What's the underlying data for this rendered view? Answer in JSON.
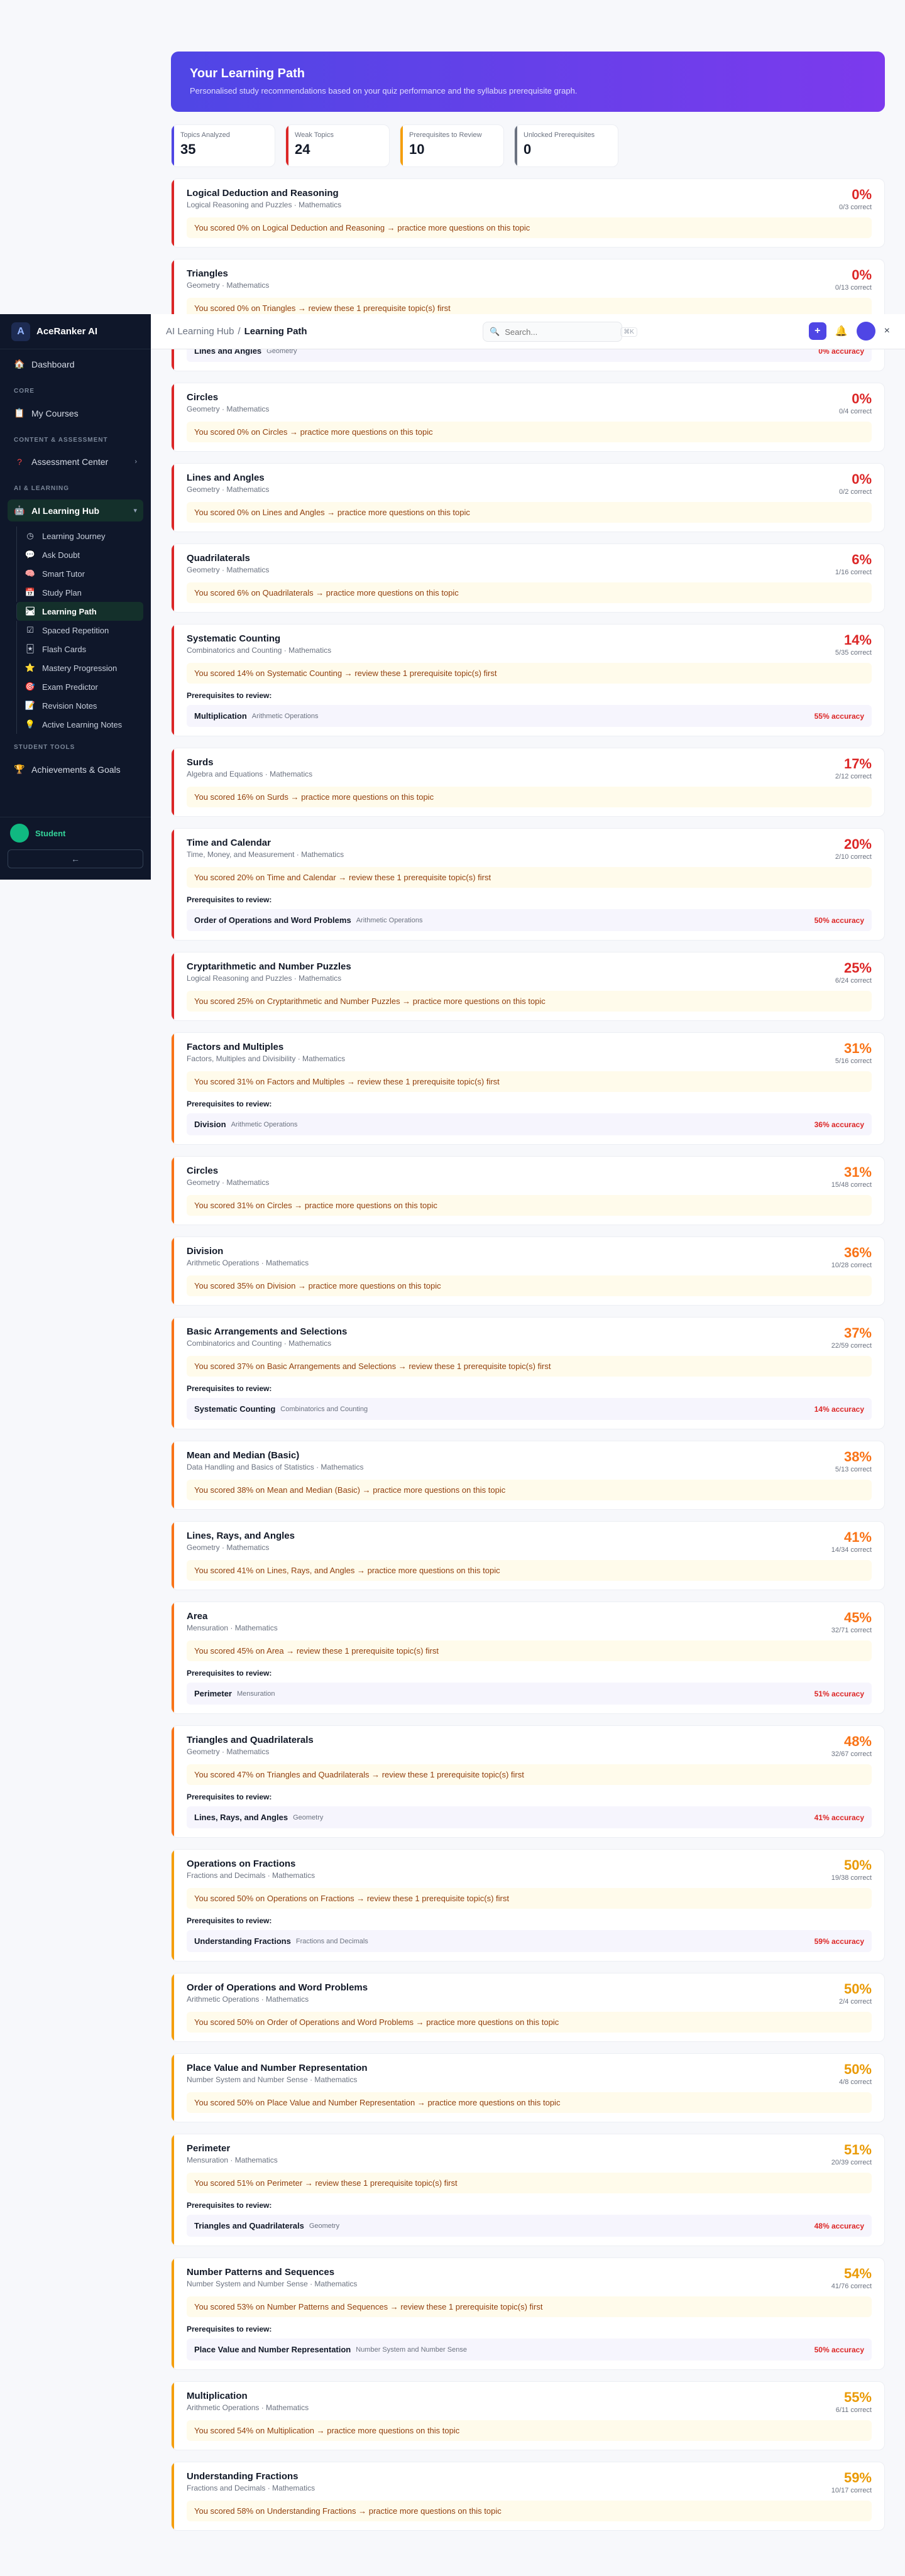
{
  "brand": {
    "logo": "A",
    "name": "AceRanker AI"
  },
  "sidebar": {
    "dashboard": "Dashboard",
    "section_core": "CORE",
    "my_courses": "My Courses",
    "section_content": "CONTENT & ASSESSMENT",
    "assessment_center": "Assessment Center",
    "section_ai": "AI & LEARNING",
    "ai_hub": "AI Learning Hub",
    "sub_items": [
      {
        "label": "Learning Journey",
        "icon": "clock-icon",
        "glyph": "◷"
      },
      {
        "label": "Ask Doubt",
        "icon": "chat-icon",
        "glyph": "💬"
      },
      {
        "label": "Smart Tutor",
        "icon": "brain-icon",
        "glyph": "🧠"
      },
      {
        "label": "Study Plan",
        "icon": "calendar-icon",
        "glyph": "📅"
      },
      {
        "label": "Learning Path",
        "icon": "path-icon",
        "glyph": "🛤"
      },
      {
        "label": "Spaced Repetition",
        "icon": "check-icon",
        "glyph": "☑"
      },
      {
        "label": "Flash Cards",
        "icon": "cards-icon",
        "glyph": "🃏"
      },
      {
        "label": "Mastery Progression",
        "icon": "star-icon",
        "glyph": "⭐"
      },
      {
        "label": "Exam Predictor",
        "icon": "target-icon",
        "glyph": "🎯"
      },
      {
        "label": "Revision Notes",
        "icon": "notes-icon",
        "glyph": "📝"
      },
      {
        "label": "Active Learning Notes",
        "icon": "bulb-icon",
        "glyph": "💡"
      }
    ],
    "section_tools": "STUDENT TOOLS",
    "achievements": "Achievements & Goals",
    "user_name": "Student",
    "collapse": "←"
  },
  "topbar": {
    "crumb_parent": "AI Learning Hub",
    "crumb_sep": "/",
    "crumb_current": "Learning Path",
    "search_placeholder": "Search...",
    "search_kbd": "⌘K",
    "add": "+",
    "bell": "🔔",
    "close": "×"
  },
  "hero": {
    "title": "Your Learning Path",
    "subtitle": "Personalised study recommendations based on your quiz performance and the syllabus prerequisite graph."
  },
  "stats": [
    {
      "label": "Topics Analyzed",
      "value": "35"
    },
    {
      "label": "Weak Topics",
      "value": "24"
    },
    {
      "label": "Prerequisites to Review",
      "value": "10"
    },
    {
      "label": "Unlocked Prerequisites",
      "value": "0"
    }
  ],
  "prereq_label": "Prerequisites to review:",
  "topics": [
    {
      "title": "Logical Deduction and Reasoning",
      "sub": "Logical Reasoning and Puzzles · Mathematics",
      "pct": "0%",
      "correct": "0/3 correct",
      "tone": "red",
      "reco": "You scored 0% on Logical Deduction and Reasoning → practice more questions on this topic"
    },
    {
      "title": "Triangles",
      "sub": "Geometry · Mathematics",
      "pct": "0%",
      "correct": "0/13 correct",
      "tone": "red",
      "reco": "You scored 0% on Triangles → review these 1 prerequisite topic(s) first",
      "prereq": {
        "name": "Lines and Angles",
        "sub": "Geometry",
        "acc": "0% accuracy"
      }
    },
    {
      "title": "Circles",
      "sub": "Geometry · Mathematics",
      "pct": "0%",
      "correct": "0/4 correct",
      "tone": "red",
      "reco": "You scored 0% on Circles → practice more questions on this topic"
    },
    {
      "title": "Lines and Angles",
      "sub": "Geometry · Mathematics",
      "pct": "0%",
      "correct": "0/2 correct",
      "tone": "red",
      "reco": "You scored 0% on Lines and Angles → practice more questions on this topic"
    },
    {
      "title": "Quadrilaterals",
      "sub": "Geometry · Mathematics",
      "pct": "6%",
      "correct": "1/16 correct",
      "tone": "red",
      "reco": "You scored 6% on Quadrilaterals → practice more questions on this topic"
    },
    {
      "title": "Systematic Counting",
      "sub": "Combinatorics and Counting · Mathematics",
      "pct": "14%",
      "correct": "5/35 correct",
      "tone": "red",
      "reco": "You scored 14% on Systematic Counting → review these 1 prerequisite topic(s) first",
      "prereq": {
        "name": "Multiplication",
        "sub": "Arithmetic Operations",
        "acc": "55% accuracy"
      }
    },
    {
      "title": "Surds",
      "sub": "Algebra and Equations · Mathematics",
      "pct": "17%",
      "correct": "2/12 correct",
      "tone": "red",
      "reco": "You scored 16% on Surds → practice more questions on this topic"
    },
    {
      "title": "Time and Calendar",
      "sub": "Time, Money, and Measurement · Mathematics",
      "pct": "20%",
      "correct": "2/10 correct",
      "tone": "red",
      "reco": "You scored 20% on Time and Calendar → review these 1 prerequisite topic(s) first",
      "prereq": {
        "name": "Order of Operations and Word Problems",
        "sub": "Arithmetic Operations",
        "acc": "50% accuracy"
      }
    },
    {
      "title": "Cryptarithmetic and Number Puzzles",
      "sub": "Logical Reasoning and Puzzles · Mathematics",
      "pct": "25%",
      "correct": "6/24 correct",
      "tone": "red",
      "reco": "You scored 25% on Cryptarithmetic and Number Puzzles → practice more questions on this topic"
    },
    {
      "title": "Factors and Multiples",
      "sub": "Factors, Multiples and Divisibility · Mathematics",
      "pct": "31%",
      "correct": "5/16 correct",
      "tone": "orange",
      "reco": "You scored 31% on Factors and Multiples → review these 1 prerequisite topic(s) first",
      "prereq": {
        "name": "Division",
        "sub": "Arithmetic Operations",
        "acc": "36% accuracy"
      }
    },
    {
      "title": "Circles",
      "sub": "Geometry · Mathematics",
      "pct": "31%",
      "correct": "15/48 correct",
      "tone": "orange",
      "reco": "You scored 31% on Circles → practice more questions on this topic"
    },
    {
      "title": "Division",
      "sub": "Arithmetic Operations · Mathematics",
      "pct": "36%",
      "correct": "10/28 correct",
      "tone": "orange",
      "reco": "You scored 35% on Division → practice more questions on this topic"
    },
    {
      "title": "Basic Arrangements and Selections",
      "sub": "Combinatorics and Counting · Mathematics",
      "pct": "37%",
      "correct": "22/59 correct",
      "tone": "orange",
      "reco": "You scored 37% on Basic Arrangements and Selections → review these 1 prerequisite topic(s) first",
      "prereq": {
        "name": "Systematic Counting",
        "sub": "Combinatorics and Counting",
        "acc": "14% accuracy"
      }
    },
    {
      "title": "Mean and Median (Basic)",
      "sub": "Data Handling and Basics of Statistics · Mathematics",
      "pct": "38%",
      "correct": "5/13 correct",
      "tone": "orange",
      "reco": "You scored 38% on Mean and Median (Basic) → practice more questions on this topic"
    },
    {
      "title": "Lines, Rays, and Angles",
      "sub": "Geometry · Mathematics",
      "pct": "41%",
      "correct": "14/34 correct",
      "tone": "orange",
      "reco": "You scored 41% on Lines, Rays, and Angles → practice more questions on this topic"
    },
    {
      "title": "Area",
      "sub": "Mensuration · Mathematics",
      "pct": "45%",
      "correct": "32/71 correct",
      "tone": "orange",
      "reco": "You scored 45% on Area → review these 1 prerequisite topic(s) first",
      "prereq": {
        "name": "Perimeter",
        "sub": "Mensuration",
        "acc": "51% accuracy"
      }
    },
    {
      "title": "Triangles and Quadrilaterals",
      "sub": "Geometry · Mathematics",
      "pct": "48%",
      "correct": "32/67 correct",
      "tone": "orange",
      "reco": "You scored 47% on Triangles and Quadrilaterals → review these 1 prerequisite topic(s) first",
      "prereq": {
        "name": "Lines, Rays, and Angles",
        "sub": "Geometry",
        "acc": "41% accuracy"
      }
    },
    {
      "title": "Operations on Fractions",
      "sub": "Fractions and Decimals · Mathematics",
      "pct": "50%",
      "correct": "19/38 correct",
      "tone": "amber",
      "reco": "You scored 50% on Operations on Fractions → review these 1 prerequisite topic(s) first",
      "prereq": {
        "name": "Understanding Fractions",
        "sub": "Fractions and Decimals",
        "acc": "59% accuracy"
      }
    },
    {
      "title": "Order of Operations and Word Problems",
      "sub": "Arithmetic Operations · Mathematics",
      "pct": "50%",
      "correct": "2/4 correct",
      "tone": "amber",
      "reco": "You scored 50% on Order of Operations and Word Problems → practice more questions on this topic"
    },
    {
      "title": "Place Value and Number Representation",
      "sub": "Number System and Number Sense · Mathematics",
      "pct": "50%",
      "correct": "4/8 correct",
      "tone": "amber",
      "reco": "You scored 50% on Place Value and Number Representation → practice more questions on this topic"
    },
    {
      "title": "Perimeter",
      "sub": "Mensuration · Mathematics",
      "pct": "51%",
      "correct": "20/39 correct",
      "tone": "amber",
      "reco": "You scored 51% on Perimeter → review these 1 prerequisite topic(s) first",
      "prereq": {
        "name": "Triangles and Quadrilaterals",
        "sub": "Geometry",
        "acc": "48% accuracy"
      }
    },
    {
      "title": "Number Patterns and Sequences",
      "sub": "Number System and Number Sense · Mathematics",
      "pct": "54%",
      "correct": "41/76 correct",
      "tone": "amber",
      "reco": "You scored 53% on Number Patterns and Sequences → review these 1 prerequisite topic(s) first",
      "prereq": {
        "name": "Place Value and Number Representation",
        "sub": "Number System and Number Sense",
        "acc": "50% accuracy"
      }
    },
    {
      "title": "Multiplication",
      "sub": "Arithmetic Operations · Mathematics",
      "pct": "55%",
      "correct": "6/11 correct",
      "tone": "amber",
      "reco": "You scored 54% on Multiplication → practice more questions on this topic"
    },
    {
      "title": "Understanding Fractions",
      "sub": "Fractions and Decimals · Mathematics",
      "pct": "59%",
      "correct": "10/17 correct",
      "tone": "amber",
      "reco": "You scored 58% on Understanding Fractions → practice more questions on this topic"
    }
  ]
}
